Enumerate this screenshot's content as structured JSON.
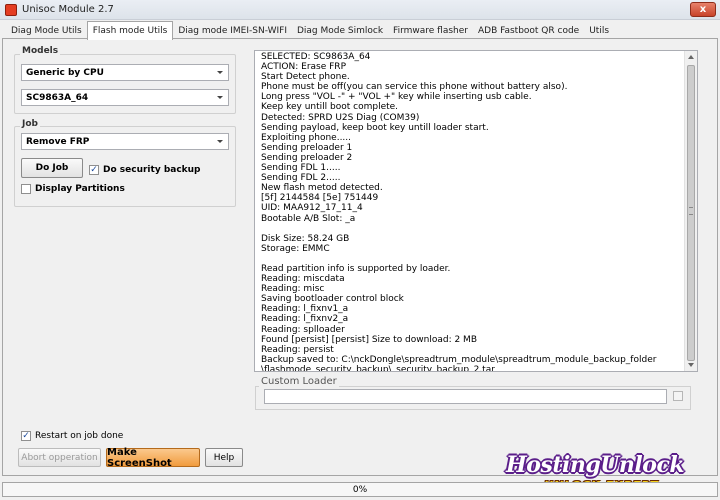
{
  "window": {
    "title": "Unisoc Module 2.7",
    "close_label": "x"
  },
  "tabs": [
    {
      "label": "Diag Mode Utils"
    },
    {
      "label": "Flash mode Utils"
    },
    {
      "label": "Diag mode IMEI-SN-WIFI"
    },
    {
      "label": "Diag Mode Simlock"
    },
    {
      "label": "Firmware flasher"
    },
    {
      "label": "ADB Fastboot QR code"
    },
    {
      "label": "Utils"
    }
  ],
  "active_tab": "Flash mode Utils",
  "models": {
    "label": "Models",
    "vendor_value": "Generic by CPU",
    "cpu_value": "SC9863A_64"
  },
  "job": {
    "label": "Job",
    "job_value": "Remove FRP",
    "do_job_label": "Do Job",
    "security_backup_label": "Do security backup",
    "security_backup_checked": true,
    "display_partitions_label": "Display Partitions",
    "display_partitions_checked": false
  },
  "log": {
    "lines": [
      "SELECTED: SC9863A_64",
      "ACTION: Erase FRP",
      "Start Detect phone.",
      "Phone must be off(you can service this phone without battery also).",
      "Long press \"VOL -\" + \"VOL +\" key while inserting usb cable.",
      "Keep key untill boot complete.",
      "Detected: SPRD U2S Diag (COM39)",
      "Sending payload, keep boot key untill loader start.",
      "Exploiting phone.....",
      "Sending preloader 1",
      "Sending preloader 2",
      "Sending FDL 1.....",
      "Sending FDL 2.....",
      "New flash metod detected.",
      "[5f] 2144584 [5e] 751449",
      "UID: MAA912_17_11_4",
      "Bootable A/B Slot: _a",
      "",
      "Disk Size: 58.24 GB",
      "Storage: EMMC",
      "",
      "Read partition info is supported by loader.",
      "Reading: miscdata",
      "Reading: misc",
      "Saving bootloader control block",
      "Reading: l_fixnv1_a",
      "Reading: l_fixnv2_a",
      "Reading: splloader",
      "Found [persist] [persist] Size to download: 2 MB",
      "Reading: persist",
      "Backup saved to: C:\\nckDongle\\spreadtrum_module\\spreadtrum_module_backup_folder",
      "\\flashmode_security_backup\\_security_backup_2.tar"
    ]
  },
  "custom_loader": {
    "label": "Custom Loader",
    "value": ""
  },
  "bottom": {
    "restart_label": "Restart on job done",
    "restart_checked": true,
    "abort_label": "Abort opperation",
    "screenshot_label": "Make ScreenShot",
    "help_label": "Help"
  },
  "progress": {
    "value": 0,
    "text": "0%"
  },
  "watermark": {
    "main": "HostingUnlock",
    "sub": "UNLOCK EXPERT"
  },
  "colors": {
    "accent_button": "#f19b3d",
    "progress_fill": "#2ec44a",
    "watermark": "#5b1e8a"
  }
}
